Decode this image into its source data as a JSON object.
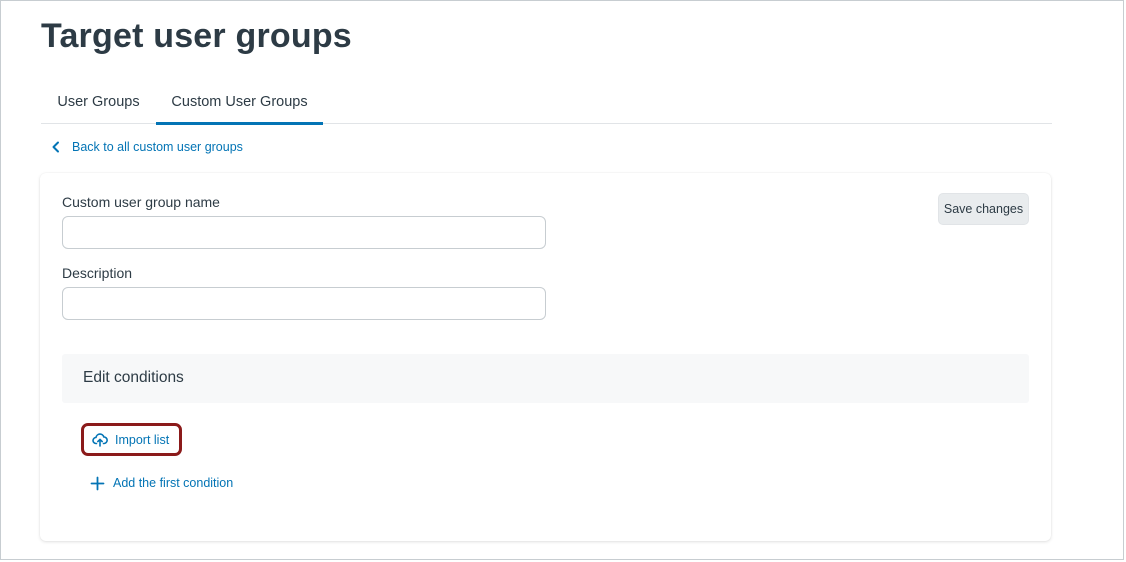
{
  "page": {
    "title": "Target user groups"
  },
  "tabs": [
    {
      "label": "User Groups",
      "active": false
    },
    {
      "label": "Custom User Groups",
      "active": true
    }
  ],
  "back_link": {
    "label": "Back to all custom user groups",
    "icon": "chevron-left-icon"
  },
  "form": {
    "name_label": "Custom user group name",
    "name_value": "",
    "description_label": "Description",
    "description_value": "",
    "save_label": "Save changes"
  },
  "conditions": {
    "title": "Edit conditions",
    "import_label": "Import list",
    "import_icon": "cloud-upload-icon",
    "add_label": "Add the first condition",
    "add_icon": "plus-icon"
  },
  "colors": {
    "link": "#0374b5",
    "active_tab": "#0374b5",
    "highlight": "#8b1a1a",
    "text": "#2d3b45"
  }
}
